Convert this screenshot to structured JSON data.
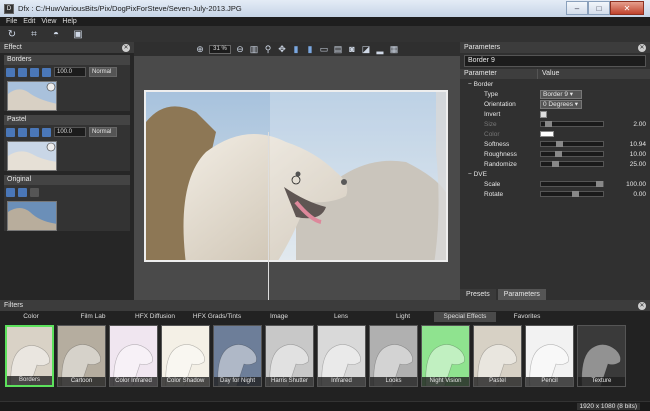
{
  "window": {
    "title": "Dfx : C:/HuwVariousBits/Pix/DogPixForSteve/Seven-July-2013.JPG",
    "app_icon": "D",
    "minimize": "–",
    "maximize": "□",
    "close": "✕"
  },
  "menu": [
    "File",
    "Edit",
    "View",
    "Help"
  ],
  "effect_panel": {
    "title": "Effect",
    "layers": [
      {
        "name": "Borders",
        "opacity": "100.0",
        "blend": "Normal"
      },
      {
        "name": "Pastel",
        "opacity": "100.0",
        "blend": "Normal"
      },
      {
        "name": "Original"
      }
    ]
  },
  "canvas": {
    "zoom": "31 %"
  },
  "parameters": {
    "title": "Parameters",
    "preset_name": "Border 9",
    "col_parameter": "Parameter",
    "col_value": "Value",
    "groups": [
      {
        "name": "Border",
        "rows": [
          {
            "label": "Type",
            "kind": "dropdown",
            "value": "Border 9"
          },
          {
            "label": "Orientation",
            "kind": "dropdown",
            "value": "0 Degrees"
          },
          {
            "label": "Invert",
            "kind": "checkbox"
          },
          {
            "label": "Size",
            "kind": "slider",
            "value": "2.00",
            "level": 0.06,
            "disabled": true
          },
          {
            "label": "Color",
            "kind": "swatch",
            "disabled": true
          },
          {
            "label": "Softness",
            "kind": "slider",
            "value": "10.94",
            "level": 0.24
          },
          {
            "label": "Roughness",
            "kind": "slider",
            "value": "10.00",
            "level": 0.22
          },
          {
            "label": "Randomize",
            "kind": "slider",
            "value": "25.00",
            "level": 0.18
          }
        ]
      },
      {
        "name": "DVE",
        "rows": [
          {
            "label": "Scale",
            "kind": "slider",
            "value": "100.00",
            "level": 0.88
          },
          {
            "label": "Rotate",
            "kind": "slider",
            "value": "0.00",
            "level": 0.5
          }
        ]
      }
    ],
    "tabs": [
      "Presets",
      "Parameters"
    ]
  },
  "filters": {
    "title": "Filters",
    "categories": [
      "Color",
      "Film Lab",
      "HFX Diffusion",
      "HFX Grads/Tints",
      "Image",
      "Lens",
      "Light",
      "Special Effects",
      "Favorites"
    ],
    "active_category": "Special Effects",
    "items": [
      "Borders",
      "Cartoon",
      "Color Infrared",
      "Color Shadow",
      "Day for Night",
      "Harris Shutter",
      "Infrared",
      "Looks",
      "Night Vision",
      "Pastel",
      "Pencil",
      "Texture"
    ],
    "selected": "Borders"
  },
  "status": {
    "resolution": "1920 x 1080 (8 bits)"
  }
}
